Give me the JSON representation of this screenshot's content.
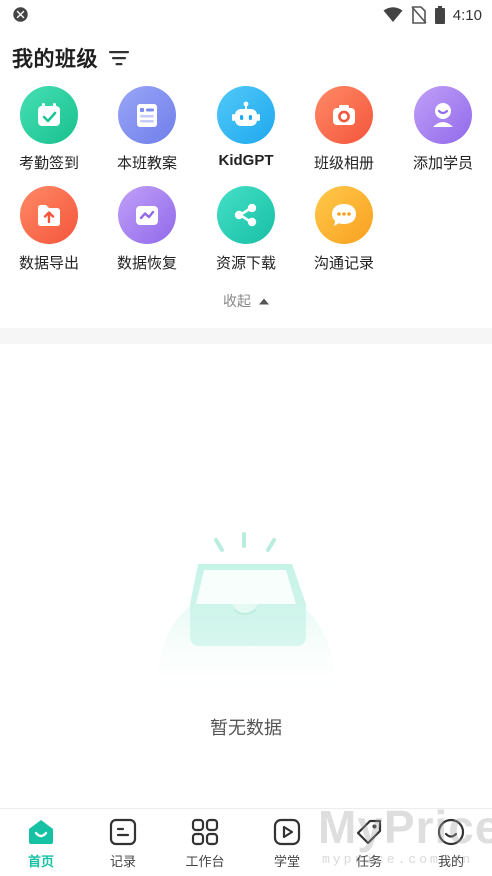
{
  "status_bar": {
    "time": "4:10"
  },
  "header": {
    "title": "我的班级"
  },
  "grid": {
    "items": [
      {
        "label": "考勤签到",
        "icon": "calendar-check-icon",
        "color": "#2ed1a2"
      },
      {
        "label": "本班教案",
        "icon": "lesson-plan-icon",
        "color": "#7c8cf0"
      },
      {
        "label": "KidGPT",
        "icon": "robot-icon",
        "color": "#34b6f2"
      },
      {
        "label": "班级相册",
        "icon": "camera-icon",
        "color": "#fb6a4c"
      },
      {
        "label": "添加学员",
        "icon": "add-student-icon",
        "color": "#a77ff0"
      },
      {
        "label": "数据导出",
        "icon": "folder-upload-icon",
        "color": "#fb6a4c"
      },
      {
        "label": "数据恢复",
        "icon": "data-restore-icon",
        "color": "#a77ff0"
      },
      {
        "label": "资源下载",
        "icon": "share-nodes-icon",
        "color": "#2ecfb4"
      },
      {
        "label": "沟通记录",
        "icon": "chat-bubble-icon",
        "color": "#fbb22a"
      }
    ]
  },
  "collapse": {
    "label": "收起"
  },
  "empty_state": {
    "text": "暂无数据"
  },
  "bottom_nav": {
    "items": [
      {
        "label": "首页",
        "icon": "home-icon",
        "active": true
      },
      {
        "label": "记录",
        "icon": "record-icon",
        "active": false
      },
      {
        "label": "工作台",
        "icon": "workbench-icon",
        "active": false
      },
      {
        "label": "学堂",
        "icon": "play-icon",
        "active": false
      },
      {
        "label": "任务",
        "icon": "tag-icon",
        "active": false
      },
      {
        "label": "我的",
        "icon": "profile-icon",
        "active": false
      }
    ]
  },
  "watermark": {
    "big": "MyPrice",
    "small": "myprice.com.cn"
  },
  "colors": {
    "accent": "#16c2a3"
  }
}
